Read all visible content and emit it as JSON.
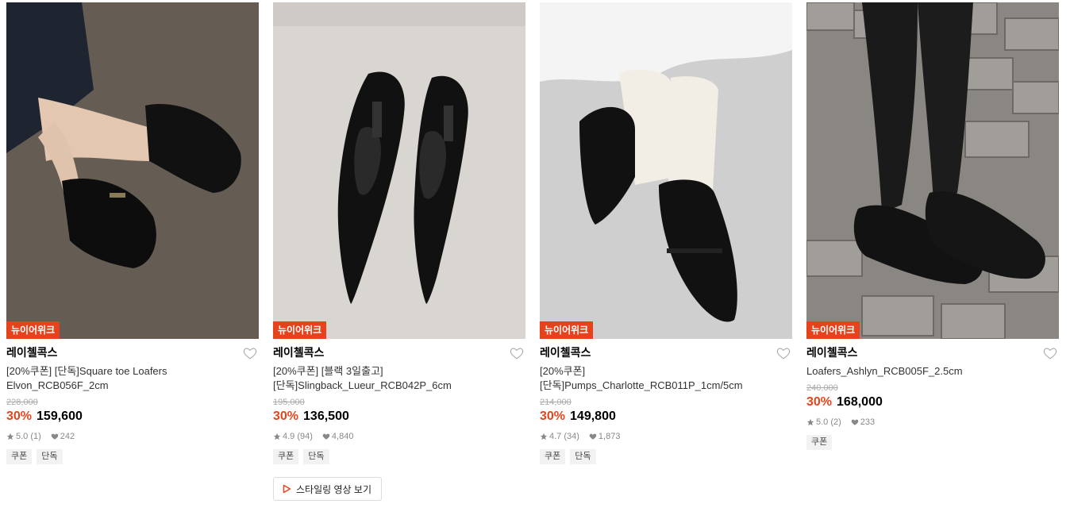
{
  "products": [
    {
      "tag": "뉴이어위크",
      "brand": "레이첼콕스",
      "name_line1": "[20%쿠폰] [단독]Square toe Loafers",
      "name_line2": "Elvon_RCB056F_2cm",
      "original_price": "228,000",
      "discount": "30%",
      "price": "159,600",
      "rating": "5.0 (1)",
      "likes": "242",
      "badges": [
        "쿠폰",
        "단독"
      ]
    },
    {
      "tag": "뉴이어위크",
      "brand": "레이첼콕스",
      "name_line1": "[20%쿠폰] [블랙 3일출고]",
      "name_line2": "[단독]Slingback_Lueur_RCB042P_6cm",
      "original_price": "195,000",
      "discount": "30%",
      "price": "136,500",
      "rating": "4.9 (94)",
      "likes": "4,840",
      "badges": [
        "쿠폰",
        "단독"
      ],
      "video_button": "스타일링 영상 보기"
    },
    {
      "tag": "뉴이어위크",
      "brand": "레이첼콕스",
      "name_line1": "[20%쿠폰]",
      "name_line2": "[단독]Pumps_Charlotte_RCB011P_1cm/5cm",
      "original_price": "214,000",
      "discount": "30%",
      "price": "149,800",
      "rating": "4.7 (34)",
      "likes": "1,873",
      "badges": [
        "쿠폰",
        "단독"
      ]
    },
    {
      "tag": "뉴이어위크",
      "brand": "레이첼콕스",
      "name_line1": "Loafers_Ashlyn_RCB005F_2.5cm",
      "original_price": "240,000",
      "discount": "30%",
      "price": "168,000",
      "rating": "5.0 (2)",
      "likes": "233",
      "badges": [
        "쿠폰"
      ]
    }
  ],
  "colors": {
    "accent": "#e8421c",
    "muted": "#888888",
    "badge_bg": "#f2f2f2"
  },
  "icons": [
    "heart-outline-icon",
    "star-icon",
    "heart-filled-icon",
    "play-icon"
  ]
}
